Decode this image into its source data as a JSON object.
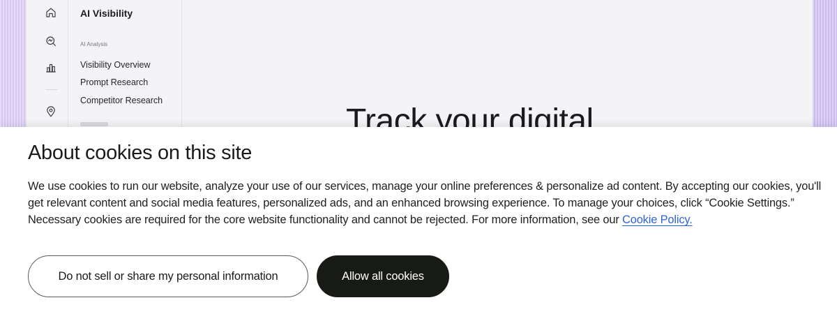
{
  "app": {
    "nav_title": "AI Visibility",
    "section_label": "AI Analysis",
    "nav_items": [
      "Visibility Overview",
      "Prompt Research",
      "Competitor Research"
    ],
    "hero_heading": "Track your digital",
    "rail_icons": [
      "home-icon",
      "search-analytics-icon",
      "bar-chart-icon",
      "location-pin-icon"
    ]
  },
  "cookie": {
    "title": "About cookies on this site",
    "body": "We use cookies to run our website, analyze your use of our services, manage your online preferences & personalize ad content. By accepting our cookies, you'll get relevant content and social media features, personalized ads, and an enhanced browsing experience. To manage your choices, click “Cookie Settings.” Necessary cookies are required for the core website functionality and cannot be rejected. For more information, see our ",
    "policy_link": "Cookie Policy.",
    "buttons": {
      "do_not_sell": "Do not sell or share my personal information",
      "allow_all": "Allow all cookies"
    },
    "colors": {
      "link": "#2e63d6",
      "primary_button": "#181a16"
    }
  }
}
